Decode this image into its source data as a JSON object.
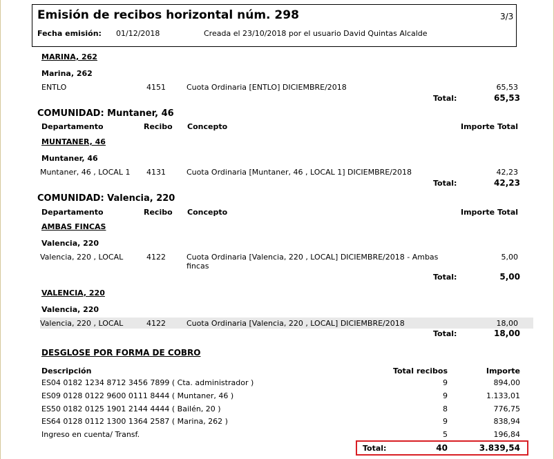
{
  "header": {
    "title": "Emisión de recibos horizontal núm. 298",
    "page": "3/3",
    "fecha_label": "Fecha emisión:",
    "fecha_value": "01/12/2018",
    "created": "Creada el 23/10/2018  por el usuario David Quintas Alcalde"
  },
  "columns": {
    "departamento": "Departamento",
    "recibo": "Recibo",
    "concepto": "Concepto",
    "importe_total": "Importe Total"
  },
  "total_label": "Total:",
  "section_marina": {
    "group": "MARINA, 262",
    "sub": "Marina, 262",
    "rows": [
      {
        "dept": "ENTLO",
        "recibo": "4151",
        "concepto": "Cuota Ordinaria [ENTLO] DICIEMBRE/2018",
        "importe": "65,53"
      }
    ],
    "total": "65,53"
  },
  "com_muntaner": {
    "title": "COMUNIDAD: Muntaner, 46",
    "group": "MUNTANER, 46",
    "sub": "Muntaner, 46",
    "rows": [
      {
        "dept": "Muntaner, 46 , LOCAL 1",
        "recibo": "4131",
        "concepto": "Cuota Ordinaria [Muntaner, 46 , LOCAL 1] DICIEMBRE/2018",
        "importe": "42,23"
      }
    ],
    "total": "42,23"
  },
  "com_valencia": {
    "title": "COMUNIDAD: Valencia, 220",
    "group1": "AMBAS FINCAS",
    "sub1": "Valencia, 220",
    "rows1": [
      {
        "dept": "Valencia, 220 , LOCAL",
        "recibo": "4122",
        "concepto": "Cuota Ordinaria [Valencia, 220 , LOCAL] DICIEMBRE/2018 - Ambas fincas",
        "importe": "5,00"
      }
    ],
    "total1": "5,00",
    "group2": "VALENCIA, 220",
    "sub2": "Valencia, 220",
    "rows2": [
      {
        "dept": "Valencia, 220 , LOCAL",
        "recibo": "4122",
        "concepto": "Cuota Ordinaria [Valencia, 220 , LOCAL] DICIEMBRE/2018",
        "importe": "18,00"
      }
    ],
    "total2": "18,00"
  },
  "desglose": {
    "title": "DESGLOSE POR FORMA DE COBRO",
    "col_descripcion": "Descripción",
    "col_total_recibos": "Total recibos",
    "col_importe": "Importe",
    "rows": [
      {
        "desc": "ES04 0182 1234 8712 3456 7899 ( Cta. administrador )",
        "count": "9",
        "importe": "894,00"
      },
      {
        "desc": "ES09 0128 0122 9600 0111 8444 ( Muntaner, 46 )",
        "count": "9",
        "importe": "1.133,01"
      },
      {
        "desc": "ES50 0182 0125 1901 2144 4444 ( Bailén, 20 )",
        "count": "8",
        "importe": "776,75"
      },
      {
        "desc": "ES64 0128 0112 1300 1364 2587 ( Marina, 262 )",
        "count": "9",
        "importe": "838,94"
      },
      {
        "desc": "Ingreso en cuenta/ Transf.",
        "count": "5",
        "importe": "196,84"
      }
    ],
    "total_label": "Total:",
    "total_count": "40",
    "total_importe": "3.839,54"
  },
  "colors": {
    "highlight": "#d81e24",
    "row_shade": "#e8e8e8"
  }
}
